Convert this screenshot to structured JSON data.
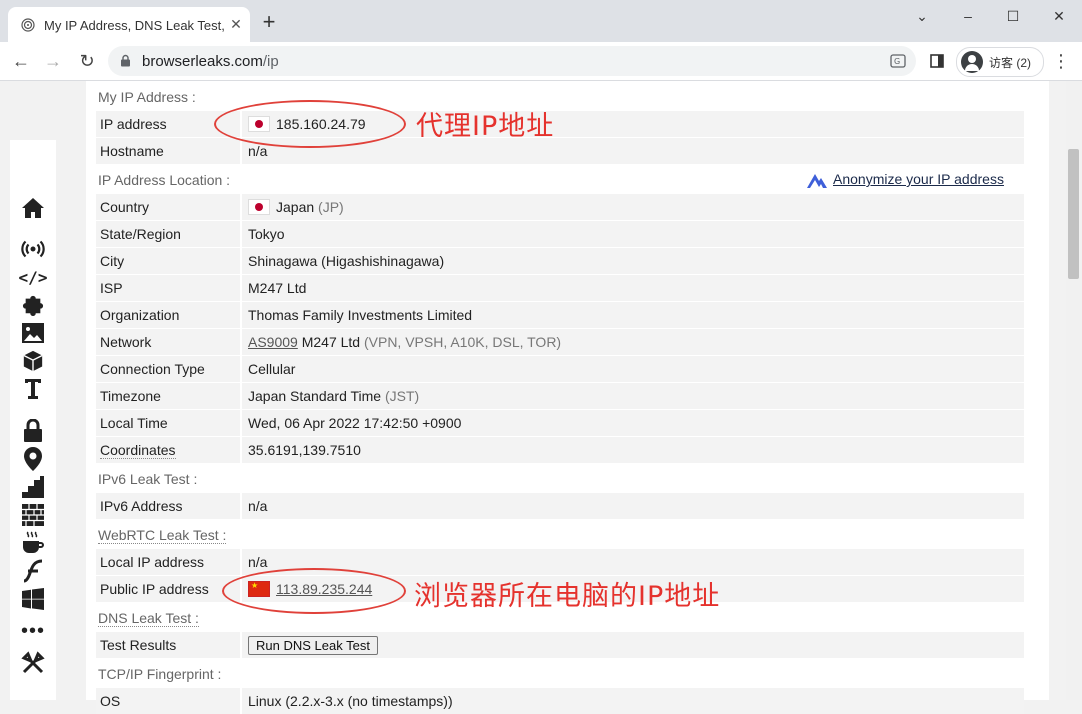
{
  "browser": {
    "tab_title": "My IP Address, DNS Leak Test,",
    "tab_close_icon": "close-icon",
    "new_tab": "+",
    "url_host": "browserleaks.com",
    "url_path": "/ip",
    "profile_label": "访客 (2)",
    "window_controls": {
      "minimize": "⌄",
      "restore": "–",
      "maximize": "☐",
      "close": "✕"
    }
  },
  "sidebar": {
    "icons": [
      "pin-icon",
      "home-icon",
      "broadcast-icon",
      "code-icon",
      "puzzle-icon",
      "image-icon",
      "cube-icon",
      "text-cursor-icon",
      "lock-icon",
      "location-pin-icon",
      "stairs-icon",
      "brick-wall-icon",
      "coffee-icon",
      "flash-icon",
      "windows-icon",
      "more-icon",
      "tools-icon"
    ]
  },
  "sections": {
    "my_ip": "My IP Address :",
    "location": "IP Address Location :",
    "ipv6": "IPv6 Leak Test :",
    "webrtc": "WebRTC Leak Test :",
    "dns": "DNS Leak Test :",
    "tcpip": "TCP/IP Fingerprint :"
  },
  "anonymize_link": "Anonymize your IP address",
  "my_ip_rows": {
    "ip_label": "IP address",
    "ip_value": "185.160.24.79",
    "hostname_label": "Hostname",
    "hostname_value": "n/a"
  },
  "location_rows": {
    "country_label": "Country",
    "country_value": "Japan",
    "country_code": "(JP)",
    "state_label": "State/Region",
    "state_value": "Tokyo",
    "city_label": "City",
    "city_value": "Shinagawa (Higashishinagawa)",
    "isp_label": "ISP",
    "isp_value": "M247 Ltd",
    "org_label": "Organization",
    "org_value": "Thomas Family Investments Limited",
    "network_label": "Network",
    "network_as": "AS9009",
    "network_name": "M247 Ltd",
    "network_tags": "(VPN, VPSH, A10K, DSL, TOR)",
    "conn_label": "Connection Type",
    "conn_value": "Cellular",
    "tz_label": "Timezone",
    "tz_value": "Japan Standard Time",
    "tz_abbr": "(JST)",
    "time_label": "Local Time",
    "time_value": "Wed, 06 Apr 2022 17:42:50 +0900",
    "coord_label": "Coordinates",
    "coord_value": "35.6191,139.7510"
  },
  "ipv6_rows": {
    "label": "IPv6 Address",
    "value": "n/a"
  },
  "webrtc_rows": {
    "local_label": "Local IP address",
    "local_value": "n/a",
    "public_label": "Public IP address",
    "public_value": "113.89.235.244"
  },
  "dns_rows": {
    "label": "Test Results",
    "button": "Run DNS Leak Test"
  },
  "tcpip_rows": {
    "label": "OS",
    "value": "Linux (2.2.x-3.x (no timestamps))"
  },
  "annotations": {
    "proxy_ip": "代理IP地址",
    "browser_ip": "浏览器所在电脑的IP地址"
  },
  "colors": {
    "annotation": "#e5322d",
    "row_bg": "#f3f3f3"
  }
}
